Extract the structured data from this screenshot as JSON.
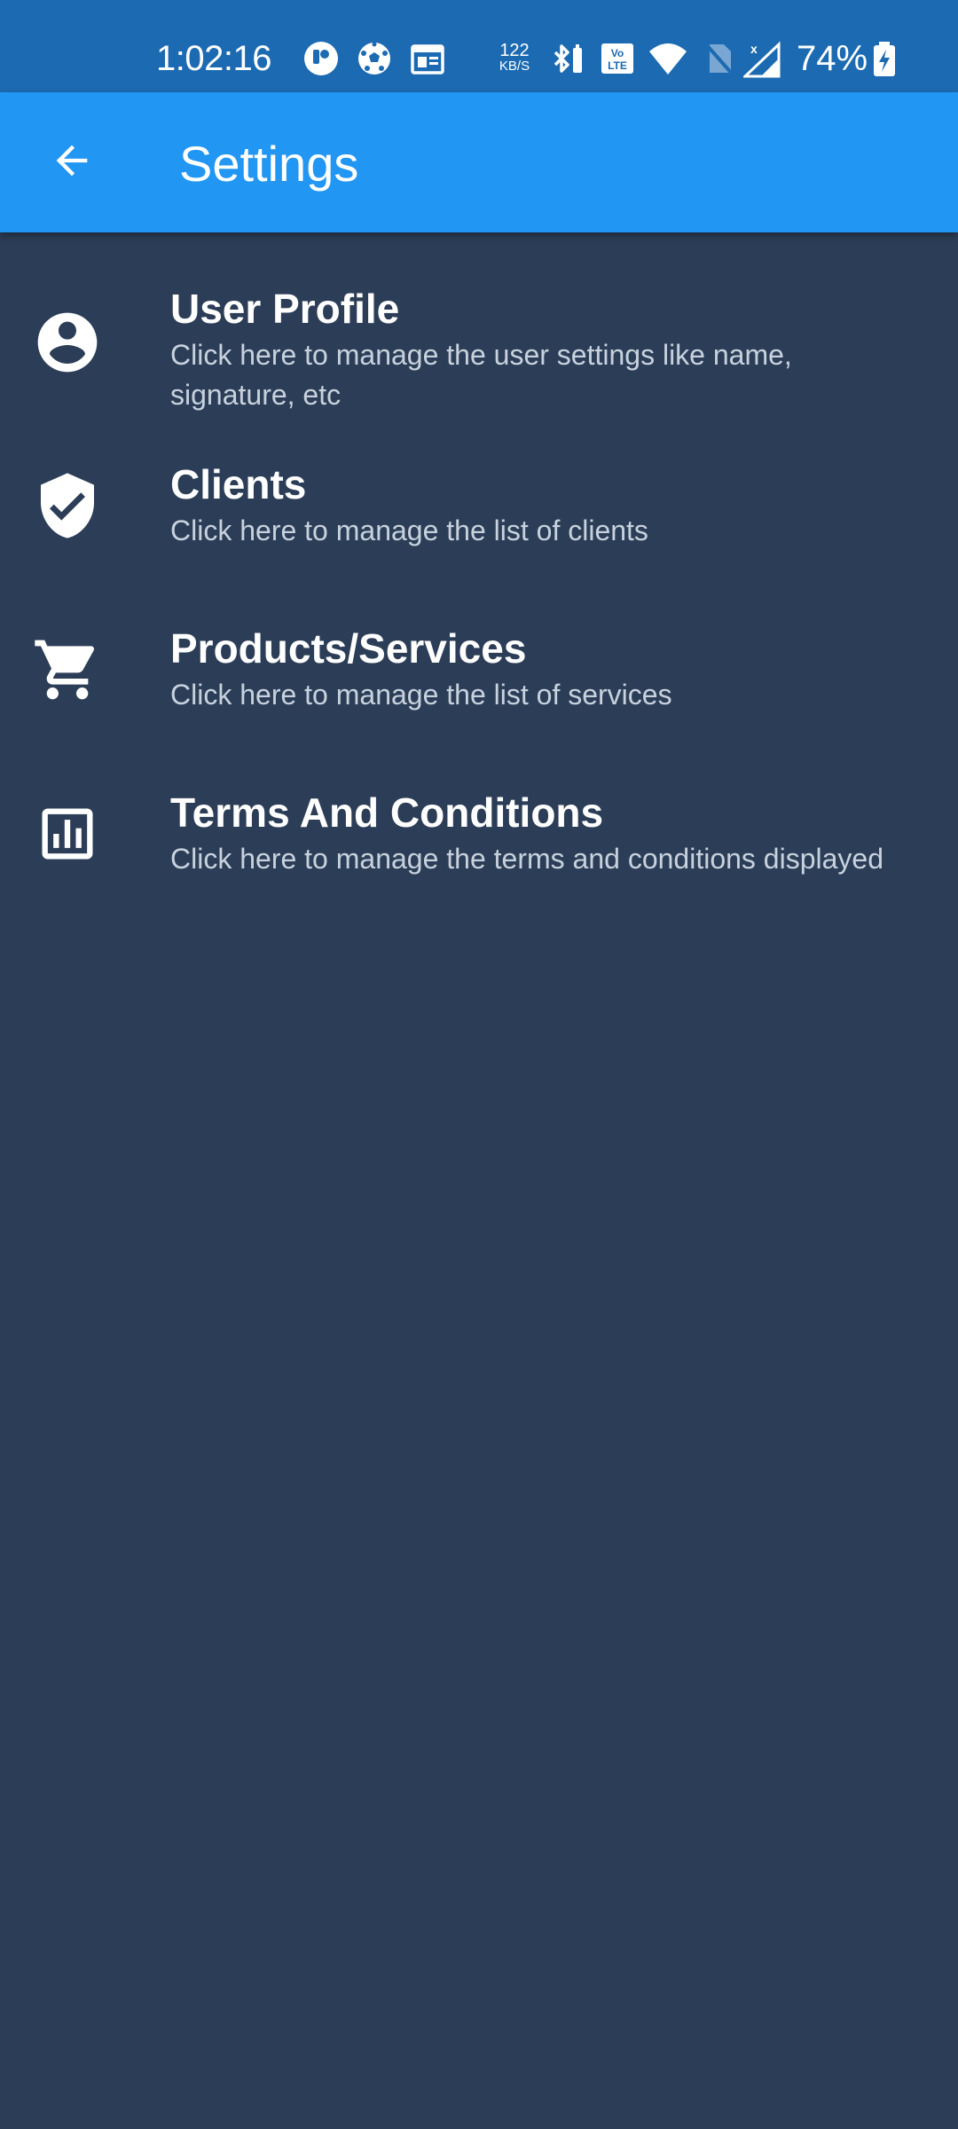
{
  "status_bar": {
    "time": "1:02:16",
    "net_speed_value": "122",
    "net_speed_unit": "KB/S",
    "battery_percent": "74%",
    "icons": [
      "app-notification-icon",
      "soccer-ball-icon",
      "calendar-icon",
      "bluetooth-icon",
      "volte-icon",
      "wifi-icon",
      "no-sim-icon",
      "signal-icon",
      "battery-charging-icon"
    ]
  },
  "app_bar": {
    "title": "Settings",
    "back_icon": "arrow-back-icon",
    "background_color": "#2196f3"
  },
  "settings": {
    "items": [
      {
        "icon": "account-circle-icon",
        "title": "User Profile",
        "subtitle": "Click here to manage the user settings like name, signature, etc"
      },
      {
        "icon": "verified-shield-icon",
        "title": "Clients",
        "subtitle": "Click here to manage the list of clients"
      },
      {
        "icon": "shopping-cart-icon",
        "title": "Products/Services",
        "subtitle": "Click here to manage the list of services"
      },
      {
        "icon": "assessment-icon",
        "title": "Terms And Conditions",
        "subtitle": "Click here to manage the terms and conditions displayed"
      }
    ]
  },
  "colors": {
    "status_bar": "#1c6ab1",
    "background": "#2c3e57",
    "subtitle": "#c8d2de"
  }
}
